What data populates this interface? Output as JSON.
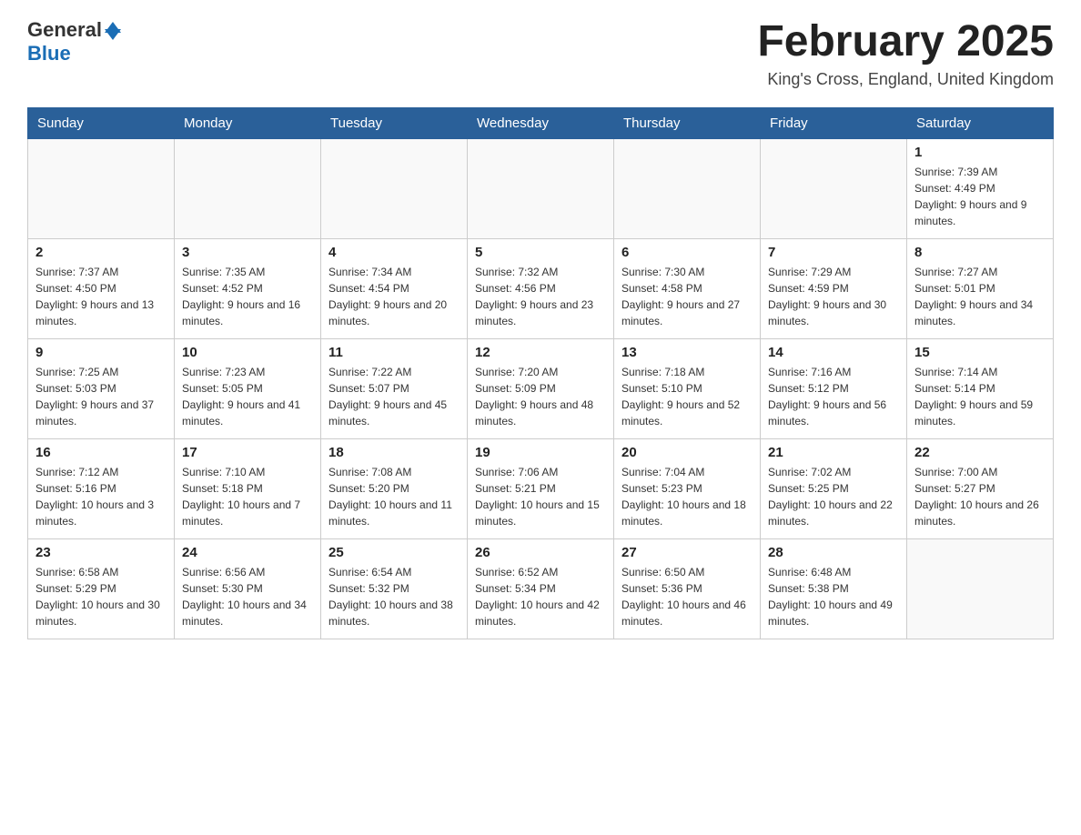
{
  "header": {
    "logo_text_general": "General",
    "logo_text_blue": "Blue",
    "month_title": "February 2025",
    "location": "King's Cross, England, United Kingdom"
  },
  "days_of_week": [
    "Sunday",
    "Monday",
    "Tuesday",
    "Wednesday",
    "Thursday",
    "Friday",
    "Saturday"
  ],
  "weeks": [
    [
      {
        "day": null,
        "sunrise": null,
        "sunset": null,
        "daylight": null
      },
      {
        "day": null,
        "sunrise": null,
        "sunset": null,
        "daylight": null
      },
      {
        "day": null,
        "sunrise": null,
        "sunset": null,
        "daylight": null
      },
      {
        "day": null,
        "sunrise": null,
        "sunset": null,
        "daylight": null
      },
      {
        "day": null,
        "sunrise": null,
        "sunset": null,
        "daylight": null
      },
      {
        "day": null,
        "sunrise": null,
        "sunset": null,
        "daylight": null
      },
      {
        "day": "1",
        "sunrise": "Sunrise: 7:39 AM",
        "sunset": "Sunset: 4:49 PM",
        "daylight": "Daylight: 9 hours and 9 minutes."
      }
    ],
    [
      {
        "day": "2",
        "sunrise": "Sunrise: 7:37 AM",
        "sunset": "Sunset: 4:50 PM",
        "daylight": "Daylight: 9 hours and 13 minutes."
      },
      {
        "day": "3",
        "sunrise": "Sunrise: 7:35 AM",
        "sunset": "Sunset: 4:52 PM",
        "daylight": "Daylight: 9 hours and 16 minutes."
      },
      {
        "day": "4",
        "sunrise": "Sunrise: 7:34 AM",
        "sunset": "Sunset: 4:54 PM",
        "daylight": "Daylight: 9 hours and 20 minutes."
      },
      {
        "day": "5",
        "sunrise": "Sunrise: 7:32 AM",
        "sunset": "Sunset: 4:56 PM",
        "daylight": "Daylight: 9 hours and 23 minutes."
      },
      {
        "day": "6",
        "sunrise": "Sunrise: 7:30 AM",
        "sunset": "Sunset: 4:58 PM",
        "daylight": "Daylight: 9 hours and 27 minutes."
      },
      {
        "day": "7",
        "sunrise": "Sunrise: 7:29 AM",
        "sunset": "Sunset: 4:59 PM",
        "daylight": "Daylight: 9 hours and 30 minutes."
      },
      {
        "day": "8",
        "sunrise": "Sunrise: 7:27 AM",
        "sunset": "Sunset: 5:01 PM",
        "daylight": "Daylight: 9 hours and 34 minutes."
      }
    ],
    [
      {
        "day": "9",
        "sunrise": "Sunrise: 7:25 AM",
        "sunset": "Sunset: 5:03 PM",
        "daylight": "Daylight: 9 hours and 37 minutes."
      },
      {
        "day": "10",
        "sunrise": "Sunrise: 7:23 AM",
        "sunset": "Sunset: 5:05 PM",
        "daylight": "Daylight: 9 hours and 41 minutes."
      },
      {
        "day": "11",
        "sunrise": "Sunrise: 7:22 AM",
        "sunset": "Sunset: 5:07 PM",
        "daylight": "Daylight: 9 hours and 45 minutes."
      },
      {
        "day": "12",
        "sunrise": "Sunrise: 7:20 AM",
        "sunset": "Sunset: 5:09 PM",
        "daylight": "Daylight: 9 hours and 48 minutes."
      },
      {
        "day": "13",
        "sunrise": "Sunrise: 7:18 AM",
        "sunset": "Sunset: 5:10 PM",
        "daylight": "Daylight: 9 hours and 52 minutes."
      },
      {
        "day": "14",
        "sunrise": "Sunrise: 7:16 AM",
        "sunset": "Sunset: 5:12 PM",
        "daylight": "Daylight: 9 hours and 56 minutes."
      },
      {
        "day": "15",
        "sunrise": "Sunrise: 7:14 AM",
        "sunset": "Sunset: 5:14 PM",
        "daylight": "Daylight: 9 hours and 59 minutes."
      }
    ],
    [
      {
        "day": "16",
        "sunrise": "Sunrise: 7:12 AM",
        "sunset": "Sunset: 5:16 PM",
        "daylight": "Daylight: 10 hours and 3 minutes."
      },
      {
        "day": "17",
        "sunrise": "Sunrise: 7:10 AM",
        "sunset": "Sunset: 5:18 PM",
        "daylight": "Daylight: 10 hours and 7 minutes."
      },
      {
        "day": "18",
        "sunrise": "Sunrise: 7:08 AM",
        "sunset": "Sunset: 5:20 PM",
        "daylight": "Daylight: 10 hours and 11 minutes."
      },
      {
        "day": "19",
        "sunrise": "Sunrise: 7:06 AM",
        "sunset": "Sunset: 5:21 PM",
        "daylight": "Daylight: 10 hours and 15 minutes."
      },
      {
        "day": "20",
        "sunrise": "Sunrise: 7:04 AM",
        "sunset": "Sunset: 5:23 PM",
        "daylight": "Daylight: 10 hours and 18 minutes."
      },
      {
        "day": "21",
        "sunrise": "Sunrise: 7:02 AM",
        "sunset": "Sunset: 5:25 PM",
        "daylight": "Daylight: 10 hours and 22 minutes."
      },
      {
        "day": "22",
        "sunrise": "Sunrise: 7:00 AM",
        "sunset": "Sunset: 5:27 PM",
        "daylight": "Daylight: 10 hours and 26 minutes."
      }
    ],
    [
      {
        "day": "23",
        "sunrise": "Sunrise: 6:58 AM",
        "sunset": "Sunset: 5:29 PM",
        "daylight": "Daylight: 10 hours and 30 minutes."
      },
      {
        "day": "24",
        "sunrise": "Sunrise: 6:56 AM",
        "sunset": "Sunset: 5:30 PM",
        "daylight": "Daylight: 10 hours and 34 minutes."
      },
      {
        "day": "25",
        "sunrise": "Sunrise: 6:54 AM",
        "sunset": "Sunset: 5:32 PM",
        "daylight": "Daylight: 10 hours and 38 minutes."
      },
      {
        "day": "26",
        "sunrise": "Sunrise: 6:52 AM",
        "sunset": "Sunset: 5:34 PM",
        "daylight": "Daylight: 10 hours and 42 minutes."
      },
      {
        "day": "27",
        "sunrise": "Sunrise: 6:50 AM",
        "sunset": "Sunset: 5:36 PM",
        "daylight": "Daylight: 10 hours and 46 minutes."
      },
      {
        "day": "28",
        "sunrise": "Sunrise: 6:48 AM",
        "sunset": "Sunset: 5:38 PM",
        "daylight": "Daylight: 10 hours and 49 minutes."
      },
      {
        "day": null,
        "sunrise": null,
        "sunset": null,
        "daylight": null
      }
    ]
  ]
}
